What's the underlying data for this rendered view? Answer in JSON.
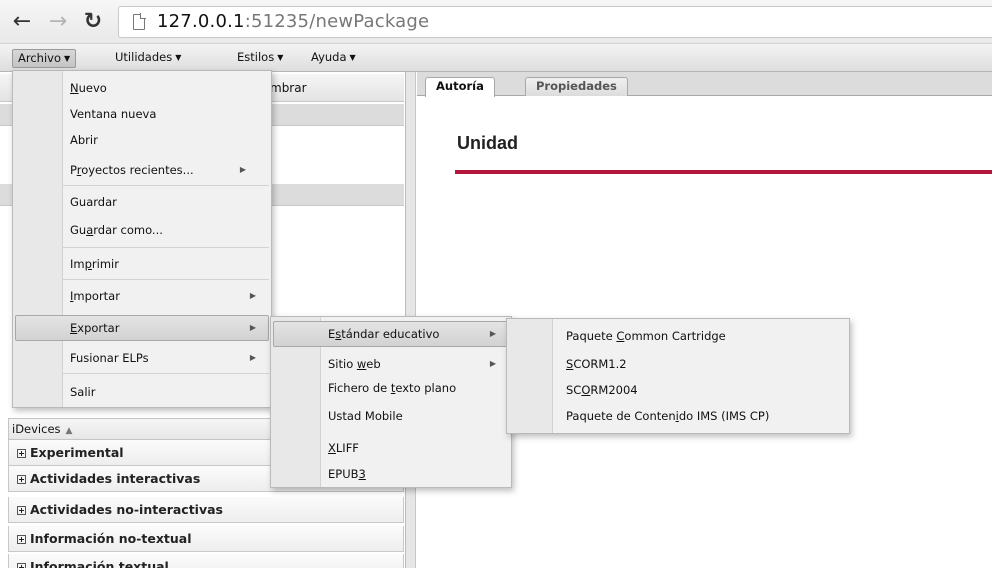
{
  "browser": {
    "url_host": "127.0.0.1",
    "url_rest": ":51235/newPackage"
  },
  "menubar": {
    "items": [
      {
        "label": "Archivo"
      },
      {
        "label": "Utilidades"
      },
      {
        "label": "Estilos"
      },
      {
        "label": "Ayuda"
      }
    ]
  },
  "archivo_menu": {
    "nuevo": "Nuevo",
    "ventana_nueva": "Ventana nueva",
    "abrir": "Abrir",
    "proyectos_recientes": "Proyectos recientes...",
    "guardar": "Guardar",
    "guardar_como": "Guardar como...",
    "imprimir": "Imprimir",
    "importar": "Importar",
    "exportar": "Exportar",
    "fusionar": "Fusionar ELPs",
    "salir": "Salir"
  },
  "exportar_menu": {
    "estandar": "Estándar educativo",
    "sitio_web": "Sitio web",
    "texto_plano": "Fichero de texto plano",
    "ustad": "Ustad Mobile",
    "xliff": "XLIFF",
    "epub3": "EPUB3"
  },
  "estandar_menu": {
    "common_cartridge": "Paquete Common Cartridge",
    "scorm12": "SCORM1.2",
    "scorm2004": "SCORM2004",
    "ims_cp": "Paquete de Contenido IMS (IMS CP)"
  },
  "left_panel": {
    "structure_header_partial": "mbrar",
    "idevices_title": "iDevices",
    "categories": [
      "Experimental",
      "Actividades interactivas",
      "Actividades no-interactivas",
      "Información no-textual",
      "Información textual"
    ]
  },
  "tabs": {
    "autoria": "Autoría",
    "propiedades": "Propiedades"
  },
  "content": {
    "unit_title": "Unidad",
    "accent_color": "#b3163a"
  }
}
